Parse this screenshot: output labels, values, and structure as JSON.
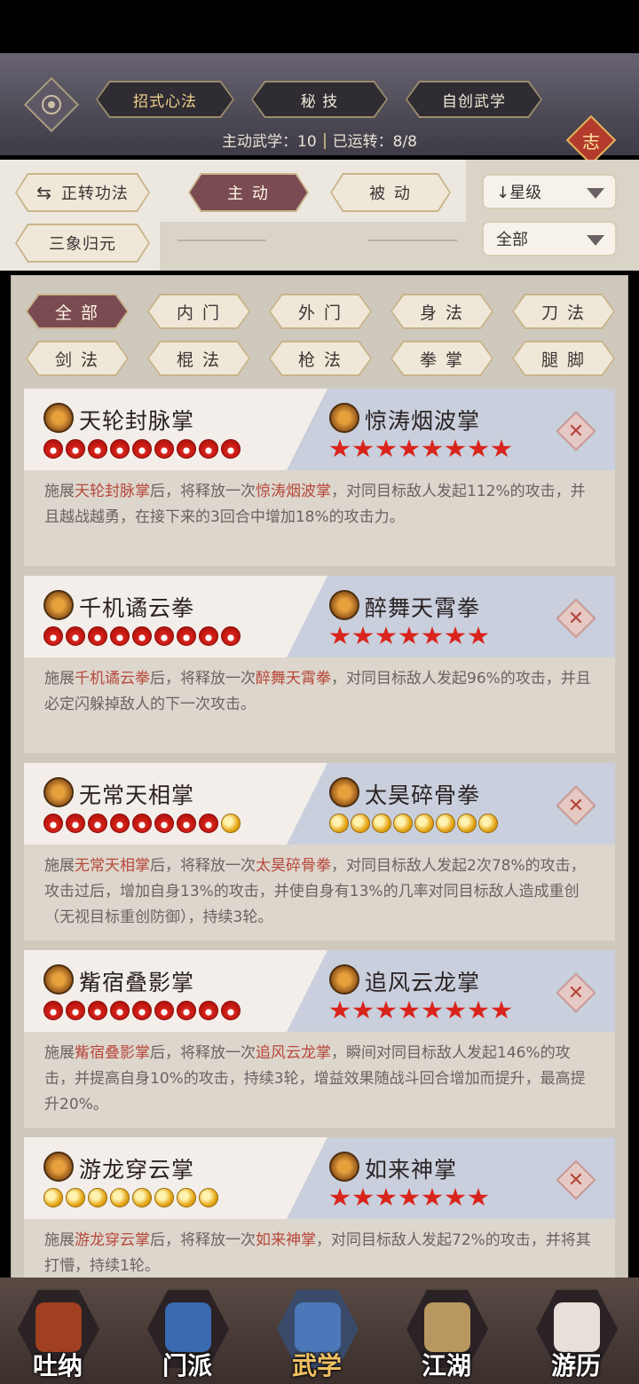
{
  "header": {
    "tabs": [
      {
        "label": "招式心法",
        "selected": true
      },
      {
        "label": "秘 技",
        "selected": false
      },
      {
        "label": "自创武学",
        "selected": false
      }
    ],
    "stats": {
      "active_label": "主动武学：10",
      "running_label": "已运转：8/8"
    },
    "knot_char": "志"
  },
  "filters": {
    "rotate_btn": "正转功法",
    "rotate_icon": "⇆",
    "mode_active": "主 动",
    "mode_passive": "被 动",
    "sanxiang_btn": "三象归元",
    "sort_select": "↓星级",
    "scope_select": "全部"
  },
  "categories": [
    {
      "label": "全 部",
      "active": true
    },
    {
      "label": "内 门",
      "active": false
    },
    {
      "label": "外 门",
      "active": false
    },
    {
      "label": "身 法",
      "active": false
    },
    {
      "label": "刀 法",
      "active": false
    },
    {
      "label": "剑 法",
      "active": false
    },
    {
      "label": "棍 法",
      "active": false
    },
    {
      "label": "枪 法",
      "active": false
    },
    {
      "label": "拳 掌",
      "active": false
    },
    {
      "label": "腿 脚",
      "active": false
    }
  ],
  "combos": [
    {
      "left_name": "天轮封脉掌",
      "left_pips": [
        "fire",
        "fire",
        "fire",
        "fire",
        "fire",
        "fire",
        "fire",
        "fire",
        "fire"
      ],
      "right_name": "惊涛烟波掌",
      "right_pips": [
        "star",
        "star",
        "star",
        "star",
        "star",
        "star",
        "star",
        "star"
      ],
      "desc_pre": "施展",
      "desc_a": "天轮封脉掌",
      "desc_mid": "后，将释放一次",
      "desc_b": "惊涛烟波掌",
      "desc_post": "，对同目标敌人发起112%的攻击，并且越战越勇，在接下来的3回合中增加18%的攻击力。"
    },
    {
      "left_name": "千机谲云拳",
      "left_pips": [
        "fire",
        "fire",
        "fire",
        "fire",
        "fire",
        "fire",
        "fire",
        "fire",
        "fire"
      ],
      "right_name": "醉舞天霄拳",
      "right_pips": [
        "star",
        "star",
        "star",
        "star",
        "star",
        "star",
        "star"
      ],
      "desc_pre": "施展",
      "desc_a": "千机谲云拳",
      "desc_mid": "后，将释放一次",
      "desc_b": "醉舞天霄拳",
      "desc_post": "，对同目标敌人发起96%的攻击，并且必定闪躲掉敌人的下一次攻击。"
    },
    {
      "left_name": "无常天相掌",
      "left_pips": [
        "fire",
        "fire",
        "fire",
        "fire",
        "fire",
        "fire",
        "fire",
        "fire",
        "moon"
      ],
      "right_name": "太昊碎骨拳",
      "right_pips": [
        "moon",
        "moon",
        "moon",
        "moon",
        "moon",
        "moon",
        "moon",
        "moon"
      ],
      "desc_pre": "施展",
      "desc_a": "无常天相掌",
      "desc_mid": "后，将释放一次",
      "desc_b": "太昊碎骨拳",
      "desc_post": "，对同目标敌人发起2次78%的攻击，攻击过后，增加自身13%的攻击，并使自身有13%的几率对同目标敌人造成重创（无视目标重创防御），持续3轮。"
    },
    {
      "left_name": "觜宿叠影掌",
      "left_pips": [
        "fire",
        "fire",
        "fire",
        "fire",
        "fire",
        "fire",
        "fire",
        "fire",
        "fire"
      ],
      "right_name": "追风云龙掌",
      "right_pips": [
        "star",
        "star",
        "star",
        "star",
        "star",
        "star",
        "star",
        "star"
      ],
      "desc_pre": "施展",
      "desc_a": "觜宿叠影掌",
      "desc_mid": "后，将释放一次",
      "desc_b": "追风云龙掌",
      "desc_post": "，瞬间对同目标敌人发起146%的攻击，并提高自身10%的攻击，持续3轮，增益效果随战斗回合增加而提升，最高提升20%。"
    },
    {
      "left_name": "游龙穿云掌",
      "left_pips": [
        "moon",
        "moon",
        "moon",
        "moon",
        "moon",
        "moon",
        "moon",
        "moon"
      ],
      "right_name": "如来神掌",
      "right_pips": [
        "star",
        "star",
        "star",
        "star",
        "star",
        "star",
        "star"
      ],
      "desc_pre": "施展",
      "desc_a": "游龙穿云掌",
      "desc_mid": "后，将释放一次",
      "desc_b": "如来神掌",
      "desc_post": "，对同目标敌人发起72%的攻击，并将其打懵，持续1轮。"
    }
  ],
  "remove_icon": "✕",
  "nav": [
    {
      "label": "吐纳",
      "active": false,
      "color": "#a04020"
    },
    {
      "label": "门派",
      "active": false,
      "color": "#3a6ab0"
    },
    {
      "label": "武学",
      "active": true,
      "color": "#4a78b8"
    },
    {
      "label": "江湖",
      "active": false,
      "color": "#b89860"
    },
    {
      "label": "游历",
      "active": false,
      "color": "#e8e0d8"
    }
  ]
}
